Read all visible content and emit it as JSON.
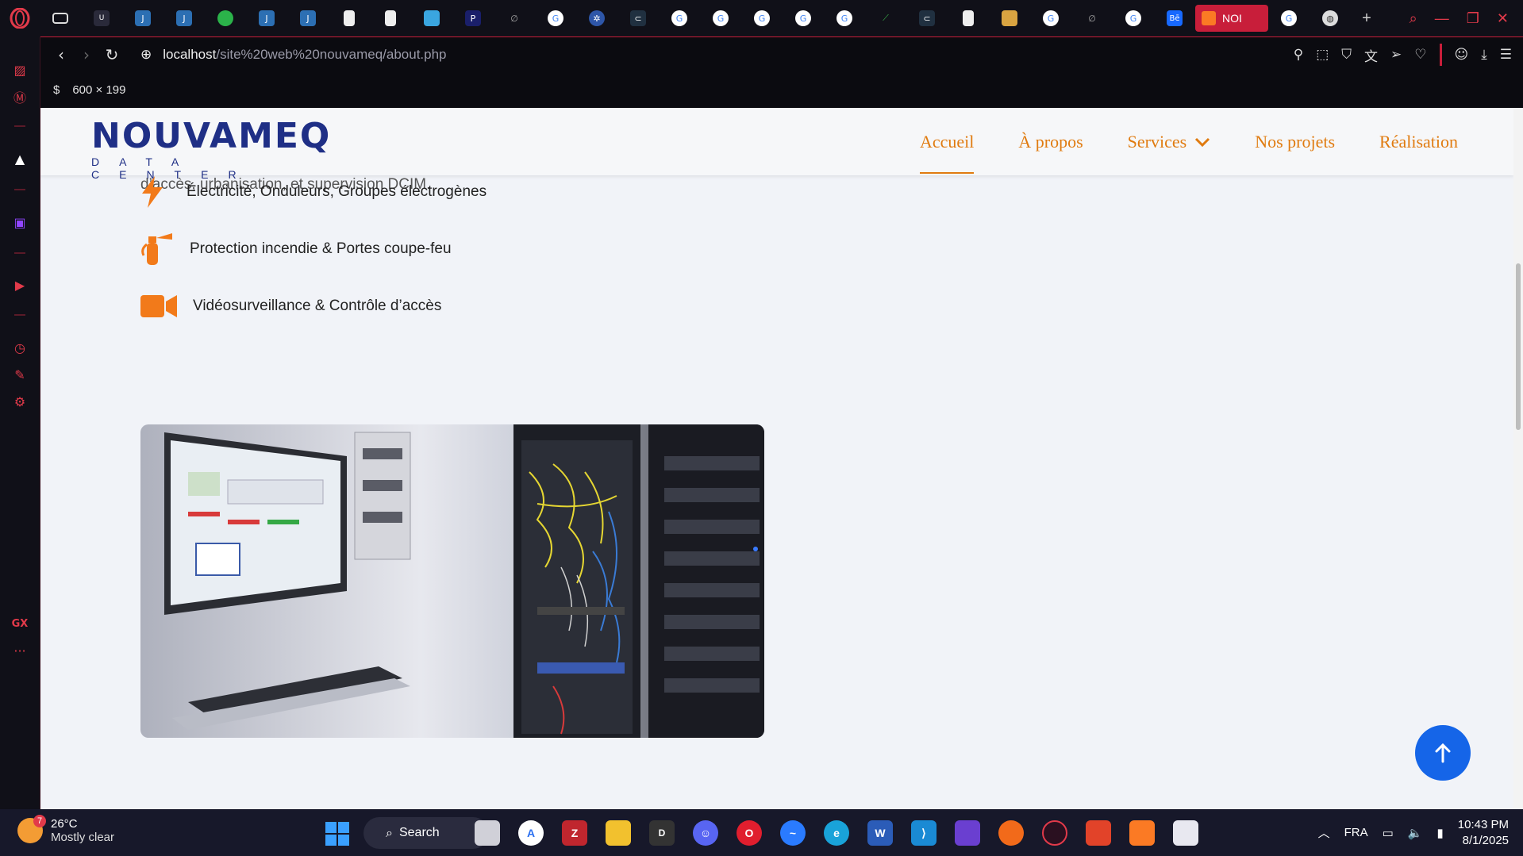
{
  "browser": {
    "tabs": {
      "active_tab_label": "NOI",
      "new_tab_symbol": "+"
    },
    "address": {
      "host": "localhost",
      "path": "/site%20web%20nouvameq/about.php"
    },
    "dimension_badge": {
      "symbol": "$",
      "text": "600 × 199"
    },
    "sidebar_label": "GX",
    "sidebar_more": "···"
  },
  "site": {
    "logo": {
      "main": "NOUVAMEQ",
      "sub": "DATA CENTER"
    },
    "menu": [
      {
        "label": "Accueil",
        "active": true
      },
      {
        "label": "À propos",
        "active": false
      },
      {
        "label": "Services",
        "active": false
      },
      {
        "label": "Nos projets",
        "active": false
      },
      {
        "label": "Réalisation",
        "active": false
      }
    ],
    "intro_text": "d’accès, urbanisation, et supervision DCIM.",
    "features": [
      {
        "icon": "bolt-icon",
        "text": "Électricité, Onduleurs, Groupes électrogènes"
      },
      {
        "icon": "fire-extinguisher-icon",
        "text": "Protection incendie & Portes coupe-feu"
      },
      {
        "icon": "video-camera-icon",
        "text": "Vidéosurveillance & Contrôle d’accès"
      }
    ],
    "accent_color": "#e07b10",
    "brand_blue": "#1f2f86"
  },
  "taskbar": {
    "weather": {
      "badge": "7",
      "temp": "26°C",
      "desc": "Mostly clear"
    },
    "search_label": "Search",
    "language": "FRA",
    "time": "10:43 PM",
    "date": "8/1/2025"
  }
}
